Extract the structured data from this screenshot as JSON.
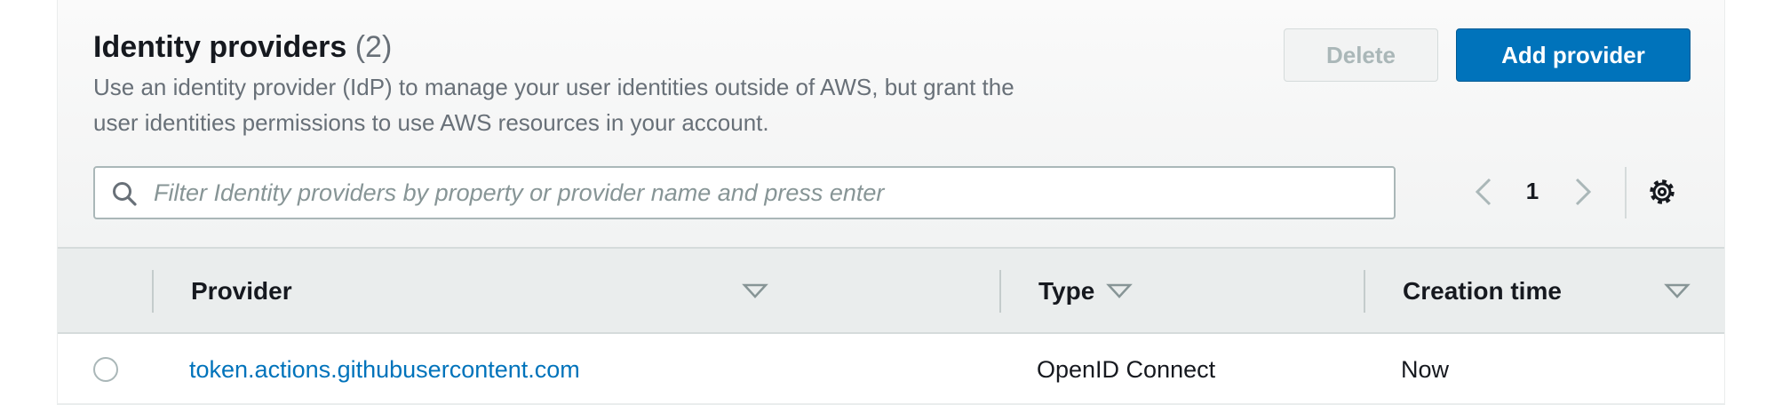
{
  "header": {
    "title": "Identity providers",
    "count": "(2)",
    "description_line1": "Use an identity provider (IdP) to manage your user identities outside of AWS, but grant the",
    "description_line2": "user identities permissions to use AWS resources in your account."
  },
  "actions": {
    "delete_label": "Delete",
    "add_label": "Add provider"
  },
  "search": {
    "placeholder": "Filter Identity providers by property or provider name and press enter",
    "value": ""
  },
  "pagination": {
    "current_page": "1"
  },
  "table": {
    "columns": [
      "Provider",
      "Type",
      "Creation time"
    ],
    "rows": [
      {
        "provider": "token.actions.githubusercontent.com",
        "type": "OpenID Connect",
        "creation_time": "Now"
      }
    ]
  },
  "icons": {
    "search": "search-icon",
    "prev": "chevron-left-icon",
    "next": "chevron-right-icon",
    "settings": "gear-icon",
    "sort": "caret-down-icon"
  },
  "colors": {
    "primary": "#0073bb",
    "text": "#16191f",
    "muted": "#687078"
  }
}
